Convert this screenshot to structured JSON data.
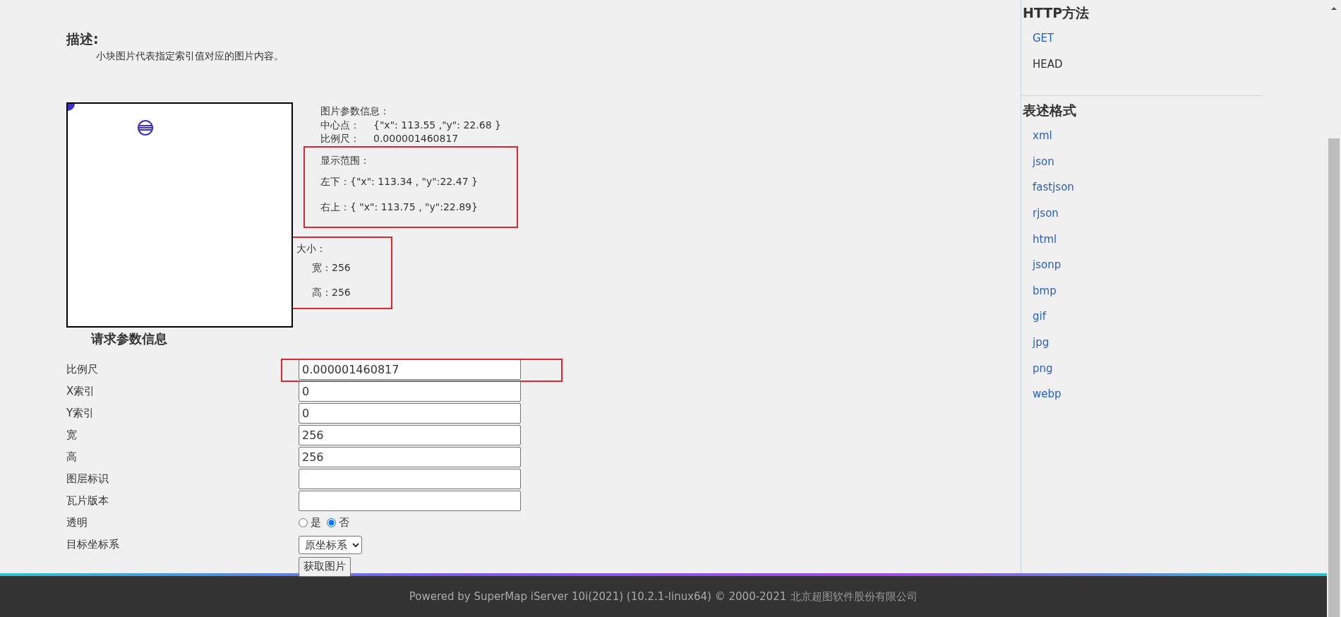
{
  "description": {
    "heading": "描述:",
    "text": "小块图片代表指定索引值对应的图片内容。"
  },
  "image_info": {
    "title": "图片参数信息：",
    "center_label": "中心点：",
    "center_value": "{\"x\": 113.55 ,\"y\": 22.68 }",
    "scale_label": "比例尺：",
    "scale_value": "0.000001460817",
    "extent": {
      "highlighted": true,
      "title": "显示范围：",
      "lines": [
        "左下：{\"x\": 113.34 , \"y\":22.47 }",
        "右上：{ \"x\": 113.75 , \"y\":22.89}"
      ]
    },
    "size": {
      "highlighted": true,
      "title": "大小：",
      "lines": [
        "宽：256",
        "高：256"
      ]
    }
  },
  "form": {
    "title": "请求参数信息",
    "fields": [
      {
        "kind": "text",
        "label": "比例尺",
        "value": "0.000001460817",
        "highlighted": true
      },
      {
        "kind": "text",
        "label": "X索引",
        "value": "0",
        "highlighted": false
      },
      {
        "kind": "text",
        "label": "Y索引",
        "value": "0",
        "highlighted": false
      },
      {
        "kind": "text",
        "label": "宽",
        "value": "256",
        "highlighted": false
      },
      {
        "kind": "text",
        "label": "高",
        "value": "256",
        "highlighted": false
      },
      {
        "kind": "text",
        "label": "图层标识",
        "highlighted": false
      },
      {
        "kind": "text",
        "label": "瓦片版本",
        "highlighted": false
      },
      {
        "kind": "radio",
        "label": "透明",
        "options": [
          {
            "label": "是",
            "selected": false
          },
          {
            "label": "否",
            "selected": true
          }
        ]
      },
      {
        "kind": "select",
        "label": "目标坐标系",
        "value": "原坐标系"
      }
    ],
    "submit": "获取图片"
  },
  "sidebar": {
    "sections": [
      {
        "title": "HTTP方法",
        "items": [
          {
            "label": "GET",
            "selected": false
          },
          {
            "label": "HEAD",
            "selected": true
          }
        ]
      },
      {
        "title": "表述格式",
        "items": [
          {
            "label": "xml",
            "selected": false
          },
          {
            "label": "json",
            "selected": false
          },
          {
            "label": "fastjson",
            "selected": false
          },
          {
            "label": "rjson",
            "selected": false
          },
          {
            "label": "html",
            "selected": false
          },
          {
            "label": "jsonp",
            "selected": false
          },
          {
            "label": "bmp",
            "selected": false
          },
          {
            "label": "gif",
            "selected": false
          },
          {
            "label": "jpg",
            "selected": false
          },
          {
            "label": "png",
            "selected": false
          },
          {
            "label": "webp",
            "selected": false
          }
        ]
      }
    ]
  },
  "footer": {
    "text": "Powered by SuperMap iServer 10i(2021) (10.2.1-linux64) © 2000-2021",
    "company": "北京超图软件股份有限公司"
  }
}
